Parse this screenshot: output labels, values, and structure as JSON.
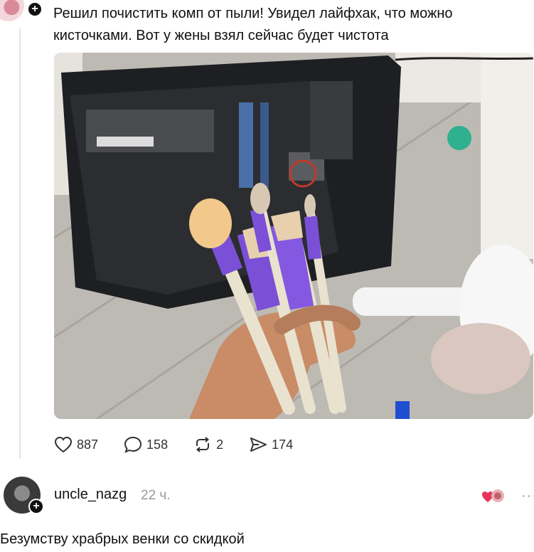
{
  "post": {
    "text": "Решил почистить комп от пыли! Увидел лайфхак, что можно кисточками. Вот у жены взял сейчас будет чистота"
  },
  "photo": {
    "label": "photo of computer case with makeup brushes in hand"
  },
  "actions": {
    "likes": "887",
    "comments": "158",
    "reposts": "2",
    "shares": "174",
    "icons": [
      "heart-icon",
      "comment-icon",
      "repost-icon",
      "share-icon"
    ]
  },
  "comment": {
    "username": "uncle_nazg",
    "time": "22 ч.",
    "text": "Безумству храбрых венки со скидкой"
  },
  "colors": {
    "accent": "#e8345a",
    "text": "#111111",
    "muted": "#9a9a9a",
    "brush_purple": "#7b4fd6"
  }
}
